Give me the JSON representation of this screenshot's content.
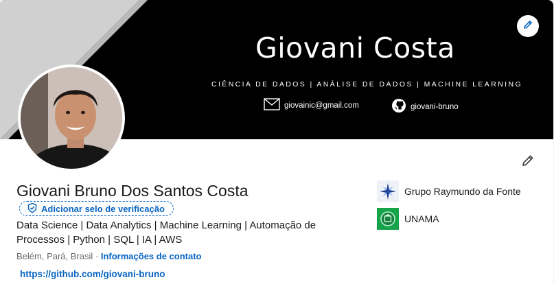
{
  "banner": {
    "name": "Giovani Costa",
    "subtitle": "CIÊNCIA DE DADOS | ANÁLISE DE DADOS | MACHINE LEARNING",
    "email": "giovainic@gmail.com",
    "github": "giovani-bruno"
  },
  "profile": {
    "name": "Giovani Bruno Dos Santos Costa",
    "verify_label": "Adicionar selo de verificação",
    "headline": "Data Science | Data Analytics | Machine Learning | Automação de Processos | Python | SQL | IA | AWS",
    "location": "Belém, Pará, Brasil",
    "separator": "·",
    "contact_info_label": "Informações de contato",
    "website": "https://github.com/giovani-bruno"
  },
  "organizations": [
    {
      "name": "Grupo Raymundo da Fonte"
    },
    {
      "name": "UNAMA"
    }
  ],
  "colors": {
    "link_blue": "#0a66c2",
    "banner_black": "#000000",
    "banner_gray": "#c8c8c8",
    "unama_green": "#16a34a"
  },
  "icons": {
    "edit_banner": "pencil-icon",
    "edit_profile": "pencil-icon",
    "verify": "shield-check-icon",
    "email": "envelope-icon",
    "github": "github-icon"
  }
}
